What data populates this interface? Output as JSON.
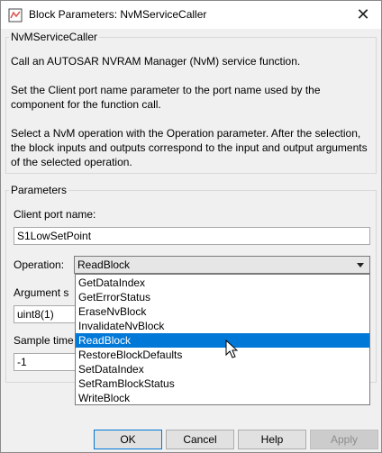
{
  "window": {
    "title": "Block Parameters: NvMServiceCaller"
  },
  "description": {
    "group_label": "NvMServiceCaller",
    "paragraphs": [
      "Call an AUTOSAR NVRAM Manager (NvM) service function.",
      "Set the Client port name parameter to the port name used by the component for the function call.",
      "Select a NvM operation with the Operation parameter.  After the selection, the block inputs and outputs correspond to the input and output arguments of the selected operation."
    ]
  },
  "parameters": {
    "group_label": "Parameters",
    "client_port_label": "Client port name:",
    "client_port_value": "S1LowSetPoint",
    "operation_label": "Operation:",
    "operation_value": "ReadBlock",
    "argument_label": "Argument s",
    "argument_value": "uint8(1)",
    "sample_time_label": "Sample time",
    "sample_time_value": "-1"
  },
  "operation_options": [
    "GetDataIndex",
    "GetErrorStatus",
    "EraseNvBlock",
    "InvalidateNvBlock",
    "ReadBlock",
    "RestoreBlockDefaults",
    "SetDataIndex",
    "SetRamBlockStatus",
    "WriteBlock"
  ],
  "selected_option_index": 4,
  "buttons": {
    "ok": "OK",
    "cancel": "Cancel",
    "help": "Help",
    "apply": "Apply"
  },
  "colors": {
    "selection": "#0078d7",
    "window_bg": "#f0f0f0"
  }
}
